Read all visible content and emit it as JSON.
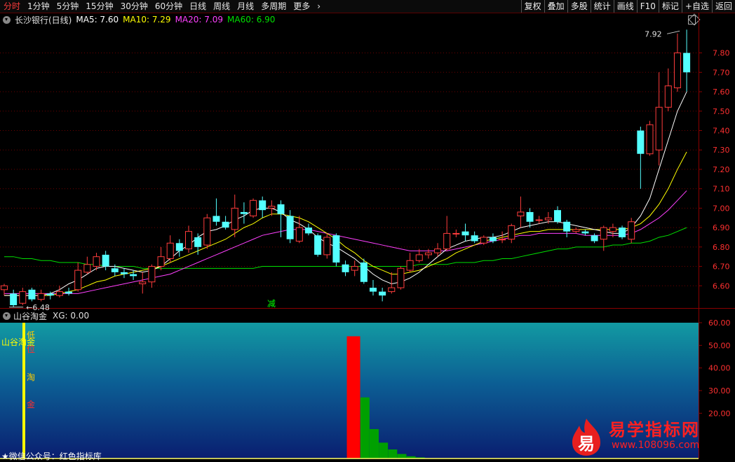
{
  "toolbar": {
    "tabs": [
      "分时",
      "1分钟",
      "5分钟",
      "15分钟",
      "30分钟",
      "60分钟",
      "日线",
      "周线",
      "月线",
      "多周期",
      "更多"
    ],
    "active_index": 0,
    "right_buttons": [
      "复权",
      "叠加",
      "多股",
      "统计",
      "画线",
      "F10",
      "标记",
      "+自选",
      "返回"
    ]
  },
  "legend": {
    "name": "长沙银行(日线)",
    "ma5": "MA5: 7.60",
    "ma10": "MA10: 7.29",
    "ma20": "MA20: 7.09",
    "ma60": "MA60: 6.90",
    "colors": {
      "ma5": "#ffffff",
      "ma10": "#ffff00",
      "ma20": "#ff40ff",
      "ma60": "#00e000"
    }
  },
  "sub_legend": {
    "name": "山谷淘金",
    "xg": "XG: 0.00"
  },
  "chart_data": [
    {
      "type": "candlestick",
      "y_axis_side": "right",
      "ylim": [
        6.5,
        7.95
      ],
      "y_ticks": [
        "7.80",
        "7.70",
        "7.60",
        "7.50",
        "7.40",
        "7.30",
        "7.20",
        "7.10",
        "7.00",
        "6.90",
        "6.80",
        "6.70",
        "6.60"
      ],
      "max_label": "7.92",
      "min_label": "6.48",
      "marker_text": "减",
      "candles": [
        [
          6.58,
          6.6,
          6.55,
          6.61
        ],
        [
          6.56,
          6.5,
          6.49,
          6.58
        ],
        [
          6.51,
          6.57,
          6.5,
          6.59
        ],
        [
          6.58,
          6.53,
          6.52,
          6.59
        ],
        [
          6.53,
          6.56,
          6.52,
          6.58
        ],
        [
          6.56,
          6.55,
          6.53,
          6.57
        ],
        [
          6.55,
          6.57,
          6.54,
          6.6
        ],
        [
          6.57,
          6.56,
          6.55,
          6.59
        ],
        [
          6.58,
          6.68,
          6.57,
          6.72
        ],
        [
          6.67,
          6.71,
          6.66,
          6.75
        ],
        [
          6.7,
          6.75,
          6.68,
          6.77
        ],
        [
          6.76,
          6.7,
          6.68,
          6.78
        ],
        [
          6.69,
          6.67,
          6.65,
          6.71
        ],
        [
          6.67,
          6.66,
          6.64,
          6.69
        ],
        [
          6.66,
          6.65,
          6.63,
          6.68
        ],
        [
          6.61,
          6.62,
          6.56,
          6.67
        ],
        [
          6.62,
          6.7,
          6.59,
          6.71
        ],
        [
          6.7,
          6.75,
          6.68,
          6.8
        ],
        [
          6.74,
          6.82,
          6.72,
          6.86
        ],
        [
          6.82,
          6.78,
          6.75,
          6.84
        ],
        [
          6.79,
          6.88,
          6.77,
          6.91
        ],
        [
          6.85,
          6.8,
          6.76,
          6.87
        ],
        [
          6.81,
          6.95,
          6.79,
          6.97
        ],
        [
          6.96,
          6.93,
          6.91,
          7.05
        ],
        [
          6.93,
          6.9,
          6.89,
          6.96
        ],
        [
          6.89,
          7.0,
          6.85,
          7.07
        ],
        [
          6.98,
          6.97,
          6.92,
          7.03
        ],
        [
          6.96,
          7.04,
          6.95,
          7.05
        ],
        [
          7.04,
          6.99,
          6.95,
          7.06
        ],
        [
          7.0,
          7.01,
          6.96,
          7.04
        ],
        [
          7.02,
          6.97,
          6.85,
          7.04
        ],
        [
          6.96,
          6.84,
          6.82,
          6.99
        ],
        [
          6.83,
          6.9,
          6.82,
          6.96
        ],
        [
          6.9,
          6.87,
          6.86,
          6.92
        ],
        [
          6.86,
          6.76,
          6.75,
          6.87
        ],
        [
          6.76,
          6.85,
          6.74,
          6.87
        ],
        [
          6.86,
          6.72,
          6.7,
          6.87
        ],
        [
          6.71,
          6.67,
          6.65,
          6.73
        ],
        [
          6.68,
          6.7,
          6.65,
          6.73
        ],
        [
          6.72,
          6.62,
          6.61,
          6.74
        ],
        [
          6.59,
          6.57,
          6.55,
          6.63
        ],
        [
          6.57,
          6.55,
          6.52,
          6.59
        ],
        [
          6.57,
          6.59,
          6.56,
          6.67
        ],
        [
          6.59,
          6.69,
          6.58,
          6.7
        ],
        [
          6.68,
          6.73,
          6.67,
          6.77
        ],
        [
          6.73,
          6.76,
          6.72,
          6.79
        ],
        [
          6.76,
          6.77,
          6.74,
          6.79
        ],
        [
          6.77,
          6.79,
          6.75,
          6.82
        ],
        [
          6.79,
          6.87,
          6.78,
          6.96
        ],
        [
          6.87,
          6.87,
          6.85,
          6.89
        ],
        [
          6.88,
          6.86,
          6.83,
          6.92
        ],
        [
          6.86,
          6.83,
          6.82,
          6.88
        ],
        [
          6.82,
          6.85,
          6.81,
          6.86
        ],
        [
          6.85,
          6.83,
          6.82,
          6.87
        ],
        [
          6.84,
          6.84,
          6.82,
          6.88
        ],
        [
          6.84,
          6.91,
          6.82,
          6.92
        ],
        [
          6.96,
          6.98,
          6.9,
          7.06
        ],
        [
          6.98,
          6.93,
          6.9,
          7.0
        ],
        [
          6.94,
          6.94,
          6.92,
          6.96
        ],
        [
          6.94,
          6.95,
          6.92,
          6.98
        ],
        [
          6.99,
          6.93,
          6.92,
          7.01
        ],
        [
          6.93,
          6.88,
          6.85,
          6.94
        ],
        [
          6.88,
          6.89,
          6.87,
          6.9
        ],
        [
          6.88,
          6.87,
          6.86,
          6.89
        ],
        [
          6.86,
          6.83,
          6.82,
          6.87
        ],
        [
          6.84,
          6.9,
          6.78,
          6.91
        ],
        [
          6.88,
          6.9,
          6.85,
          6.92
        ],
        [
          6.9,
          6.85,
          6.84,
          6.91
        ],
        [
          6.84,
          6.93,
          6.82,
          6.95
        ],
        [
          7.4,
          7.28,
          7.1,
          7.42
        ],
        [
          7.28,
          7.43,
          7.27,
          7.45
        ],
        [
          7.3,
          7.52,
          7.22,
          7.7
        ],
        [
          7.52,
          7.63,
          7.5,
          7.72
        ],
        [
          7.62,
          7.8,
          7.6,
          7.9
        ],
        [
          7.8,
          7.7,
          7.6,
          7.92
        ]
      ],
      "ma5": [
        6.55,
        6.55,
        6.55,
        6.55,
        6.55,
        6.56,
        6.58,
        6.61,
        6.63,
        6.66,
        6.69,
        6.7,
        6.7,
        6.69,
        6.68,
        6.67,
        6.68,
        6.7,
        6.74,
        6.78,
        6.81,
        6.85,
        6.88,
        6.89,
        6.91,
        6.94,
        6.96,
        6.99,
        7.0,
        7.0,
        6.98,
        6.94,
        6.92,
        6.89,
        6.85,
        6.82,
        6.8,
        6.77,
        6.74,
        6.7,
        6.66,
        6.63,
        6.61,
        6.62,
        6.64,
        6.67,
        6.71,
        6.75,
        6.79,
        6.81,
        6.83,
        6.84,
        6.85,
        6.85,
        6.86,
        6.88,
        6.9,
        6.91,
        6.92,
        6.93,
        6.93,
        6.92,
        6.91,
        6.9,
        6.89,
        6.88,
        6.87,
        6.87,
        6.9,
        6.96,
        7.05,
        7.2,
        7.35,
        7.5,
        7.6
      ],
      "ma10": [
        6.55,
        6.55,
        6.55,
        6.55,
        6.55,
        6.55,
        6.56,
        6.57,
        6.58,
        6.6,
        6.62,
        6.63,
        6.65,
        6.66,
        6.67,
        6.68,
        6.69,
        6.7,
        6.72,
        6.74,
        6.76,
        6.78,
        6.8,
        6.82,
        6.84,
        6.87,
        6.9,
        6.92,
        6.95,
        6.97,
        6.97,
        6.96,
        6.95,
        6.93,
        6.9,
        6.87,
        6.84,
        6.8,
        6.77,
        6.73,
        6.7,
        6.68,
        6.66,
        6.66,
        6.67,
        6.68,
        6.7,
        6.72,
        6.74,
        6.77,
        6.79,
        6.81,
        6.83,
        6.84,
        6.85,
        6.86,
        6.87,
        6.88,
        6.88,
        6.89,
        6.89,
        6.89,
        6.89,
        6.89,
        6.89,
        6.89,
        6.89,
        6.89,
        6.9,
        6.92,
        6.96,
        7.02,
        7.1,
        7.2,
        7.29
      ],
      "ma20": [
        6.56,
        6.56,
        6.56,
        6.56,
        6.56,
        6.56,
        6.56,
        6.56,
        6.56,
        6.57,
        6.58,
        6.59,
        6.6,
        6.61,
        6.62,
        6.63,
        6.64,
        6.65,
        6.66,
        6.68,
        6.7,
        6.72,
        6.74,
        6.76,
        6.78,
        6.8,
        6.82,
        6.84,
        6.86,
        6.87,
        6.88,
        6.89,
        6.89,
        6.89,
        6.88,
        6.87,
        6.86,
        6.85,
        6.84,
        6.83,
        6.82,
        6.81,
        6.8,
        6.79,
        6.78,
        6.78,
        6.78,
        6.78,
        6.78,
        6.79,
        6.8,
        6.81,
        6.82,
        6.83,
        6.84,
        6.85,
        6.86,
        6.86,
        6.87,
        6.87,
        6.87,
        6.87,
        6.87,
        6.86,
        6.86,
        6.86,
        6.86,
        6.86,
        6.87,
        6.89,
        6.92,
        6.95,
        6.99,
        7.04,
        7.09
      ],
      "ma60": [
        6.75,
        6.75,
        6.74,
        6.74,
        6.73,
        6.73,
        6.72,
        6.72,
        6.72,
        6.71,
        6.71,
        6.7,
        6.7,
        6.7,
        6.7,
        6.69,
        6.69,
        6.69,
        6.69,
        6.69,
        6.69,
        6.69,
        6.69,
        6.69,
        6.69,
        6.69,
        6.69,
        6.69,
        6.7,
        6.7,
        6.7,
        6.7,
        6.7,
        6.7,
        6.7,
        6.7,
        6.7,
        6.7,
        6.7,
        6.7,
        6.7,
        6.7,
        6.7,
        6.7,
        6.7,
        6.71,
        6.71,
        6.71,
        6.71,
        6.72,
        6.72,
        6.72,
        6.73,
        6.73,
        6.74,
        6.74,
        6.75,
        6.76,
        6.77,
        6.78,
        6.79,
        6.79,
        6.8,
        6.8,
        6.8,
        6.8,
        6.81,
        6.81,
        6.82,
        6.82,
        6.83,
        6.85,
        6.86,
        6.88,
        6.9
      ]
    },
    {
      "type": "bar",
      "name": "山谷淘金",
      "y_axis_side": "right",
      "ylim": [
        0,
        60
      ],
      "y_ticks": [
        "60.00",
        "50.00",
        "40.00",
        "30.00",
        "20.00"
      ],
      "red_bar": {
        "index": 37,
        "value": 54
      },
      "green_bars": [
        {
          "index": 39,
          "value": 27
        },
        {
          "index": 40,
          "value": 13
        },
        {
          "index": 41,
          "value": 7
        },
        {
          "index": 42,
          "value": 4
        },
        {
          "index": 43,
          "value": 2
        },
        {
          "index": 44,
          "value": 1
        },
        {
          "index": 45,
          "value": 0.5
        }
      ],
      "annotations": [
        "山谷淘金",
        "低",
        "位",
        "淘",
        "金"
      ]
    }
  ],
  "watermark": {
    "logo_char": "易",
    "title": "易学指标网",
    "url": "www.108096.com"
  },
  "footnote": "★微信公众号：红色指标库"
}
